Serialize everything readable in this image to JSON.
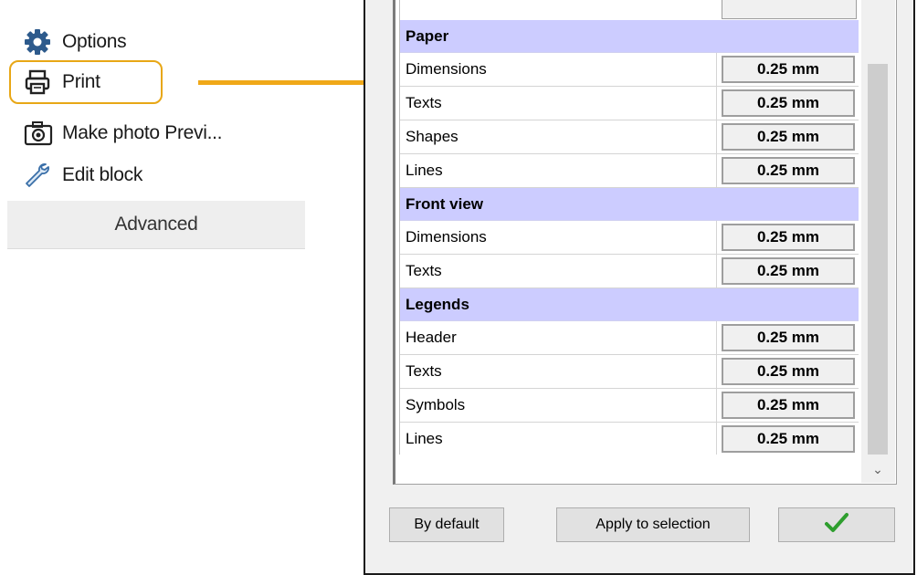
{
  "menu": {
    "items": [
      {
        "label": "Options",
        "icon": "gear-icon"
      },
      {
        "label": "Print",
        "icon": "printer-icon"
      },
      {
        "label": "Make photo Previ...",
        "icon": "camera-icon"
      },
      {
        "label": "Edit block",
        "icon": "wrench-icon"
      }
    ],
    "advanced_label": "Advanced",
    "highlight_color": "#e8a716",
    "arrow_color": "#f0a818"
  },
  "dialog": {
    "groups": [
      {
        "name": "Paper",
        "rows": [
          {
            "label": "Dimensions",
            "value": "0.25 mm"
          },
          {
            "label": "Texts",
            "value": "0.25 mm"
          },
          {
            "label": "Shapes",
            "value": "0.25 mm"
          },
          {
            "label": "Lines",
            "value": "0.25 mm"
          }
        ]
      },
      {
        "name": "Front view",
        "rows": [
          {
            "label": "Dimensions",
            "value": "0.25 mm"
          },
          {
            "label": "Texts",
            "value": "0.25 mm"
          }
        ]
      },
      {
        "name": "Legends",
        "rows": [
          {
            "label": "Header",
            "value": "0.25 mm"
          },
          {
            "label": "Texts",
            "value": "0.25 mm"
          },
          {
            "label": "Symbols",
            "value": "0.25 mm"
          },
          {
            "label": "Lines",
            "value": "0.25 mm"
          }
        ]
      }
    ],
    "group_color": "#ccccff",
    "buttons": {
      "by_default": "By default",
      "apply_to_selection": "Apply to selection",
      "ok_icon": "checkmark-icon"
    },
    "accent_check": "#2e9e2e"
  }
}
